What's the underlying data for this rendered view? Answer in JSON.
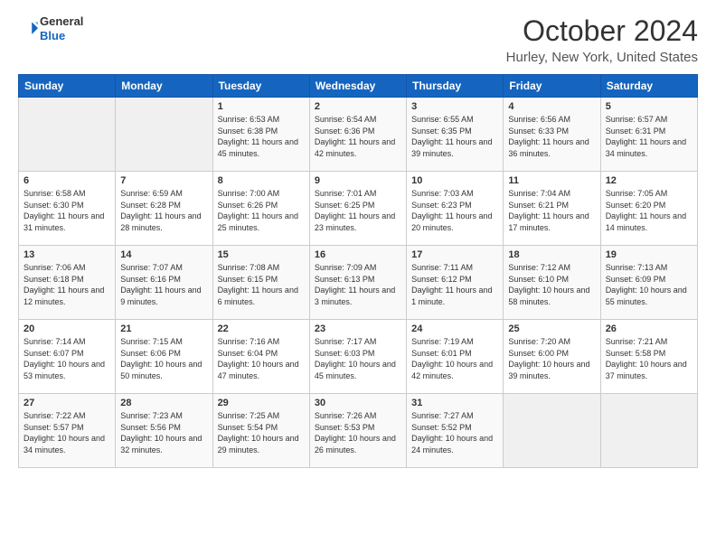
{
  "header": {
    "logo": {
      "general": "General",
      "blue": "Blue"
    },
    "title": "October 2024",
    "location": "Hurley, New York, United States"
  },
  "weekdays": [
    "Sunday",
    "Monday",
    "Tuesday",
    "Wednesday",
    "Thursday",
    "Friday",
    "Saturday"
  ],
  "weeks": [
    [
      {
        "day": "",
        "empty": true
      },
      {
        "day": "",
        "empty": true
      },
      {
        "day": "1",
        "sunrise": "6:53 AM",
        "sunset": "6:38 PM",
        "daylight": "11 hours and 45 minutes."
      },
      {
        "day": "2",
        "sunrise": "6:54 AM",
        "sunset": "6:36 PM",
        "daylight": "11 hours and 42 minutes."
      },
      {
        "day": "3",
        "sunrise": "6:55 AM",
        "sunset": "6:35 PM",
        "daylight": "11 hours and 39 minutes."
      },
      {
        "day": "4",
        "sunrise": "6:56 AM",
        "sunset": "6:33 PM",
        "daylight": "11 hours and 36 minutes."
      },
      {
        "day": "5",
        "sunrise": "6:57 AM",
        "sunset": "6:31 PM",
        "daylight": "11 hours and 34 minutes."
      }
    ],
    [
      {
        "day": "6",
        "sunrise": "6:58 AM",
        "sunset": "6:30 PM",
        "daylight": "11 hours and 31 minutes."
      },
      {
        "day": "7",
        "sunrise": "6:59 AM",
        "sunset": "6:28 PM",
        "daylight": "11 hours and 28 minutes."
      },
      {
        "day": "8",
        "sunrise": "7:00 AM",
        "sunset": "6:26 PM",
        "daylight": "11 hours and 25 minutes."
      },
      {
        "day": "9",
        "sunrise": "7:01 AM",
        "sunset": "6:25 PM",
        "daylight": "11 hours and 23 minutes."
      },
      {
        "day": "10",
        "sunrise": "7:03 AM",
        "sunset": "6:23 PM",
        "daylight": "11 hours and 20 minutes."
      },
      {
        "day": "11",
        "sunrise": "7:04 AM",
        "sunset": "6:21 PM",
        "daylight": "11 hours and 17 minutes."
      },
      {
        "day": "12",
        "sunrise": "7:05 AM",
        "sunset": "6:20 PM",
        "daylight": "11 hours and 14 minutes."
      }
    ],
    [
      {
        "day": "13",
        "sunrise": "7:06 AM",
        "sunset": "6:18 PM",
        "daylight": "11 hours and 12 minutes."
      },
      {
        "day": "14",
        "sunrise": "7:07 AM",
        "sunset": "6:16 PM",
        "daylight": "11 hours and 9 minutes."
      },
      {
        "day": "15",
        "sunrise": "7:08 AM",
        "sunset": "6:15 PM",
        "daylight": "11 hours and 6 minutes."
      },
      {
        "day": "16",
        "sunrise": "7:09 AM",
        "sunset": "6:13 PM",
        "daylight": "11 hours and 3 minutes."
      },
      {
        "day": "17",
        "sunrise": "7:11 AM",
        "sunset": "6:12 PM",
        "daylight": "11 hours and 1 minute."
      },
      {
        "day": "18",
        "sunrise": "7:12 AM",
        "sunset": "6:10 PM",
        "daylight": "10 hours and 58 minutes."
      },
      {
        "day": "19",
        "sunrise": "7:13 AM",
        "sunset": "6:09 PM",
        "daylight": "10 hours and 55 minutes."
      }
    ],
    [
      {
        "day": "20",
        "sunrise": "7:14 AM",
        "sunset": "6:07 PM",
        "daylight": "10 hours and 53 minutes."
      },
      {
        "day": "21",
        "sunrise": "7:15 AM",
        "sunset": "6:06 PM",
        "daylight": "10 hours and 50 minutes."
      },
      {
        "day": "22",
        "sunrise": "7:16 AM",
        "sunset": "6:04 PM",
        "daylight": "10 hours and 47 minutes."
      },
      {
        "day": "23",
        "sunrise": "7:17 AM",
        "sunset": "6:03 PM",
        "daylight": "10 hours and 45 minutes."
      },
      {
        "day": "24",
        "sunrise": "7:19 AM",
        "sunset": "6:01 PM",
        "daylight": "10 hours and 42 minutes."
      },
      {
        "day": "25",
        "sunrise": "7:20 AM",
        "sunset": "6:00 PM",
        "daylight": "10 hours and 39 minutes."
      },
      {
        "day": "26",
        "sunrise": "7:21 AM",
        "sunset": "5:58 PM",
        "daylight": "10 hours and 37 minutes."
      }
    ],
    [
      {
        "day": "27",
        "sunrise": "7:22 AM",
        "sunset": "5:57 PM",
        "daylight": "10 hours and 34 minutes."
      },
      {
        "day": "28",
        "sunrise": "7:23 AM",
        "sunset": "5:56 PM",
        "daylight": "10 hours and 32 minutes."
      },
      {
        "day": "29",
        "sunrise": "7:25 AM",
        "sunset": "5:54 PM",
        "daylight": "10 hours and 29 minutes."
      },
      {
        "day": "30",
        "sunrise": "7:26 AM",
        "sunset": "5:53 PM",
        "daylight": "10 hours and 26 minutes."
      },
      {
        "day": "31",
        "sunrise": "7:27 AM",
        "sunset": "5:52 PM",
        "daylight": "10 hours and 24 minutes."
      },
      {
        "day": "",
        "empty": true
      },
      {
        "day": "",
        "empty": true
      }
    ]
  ]
}
